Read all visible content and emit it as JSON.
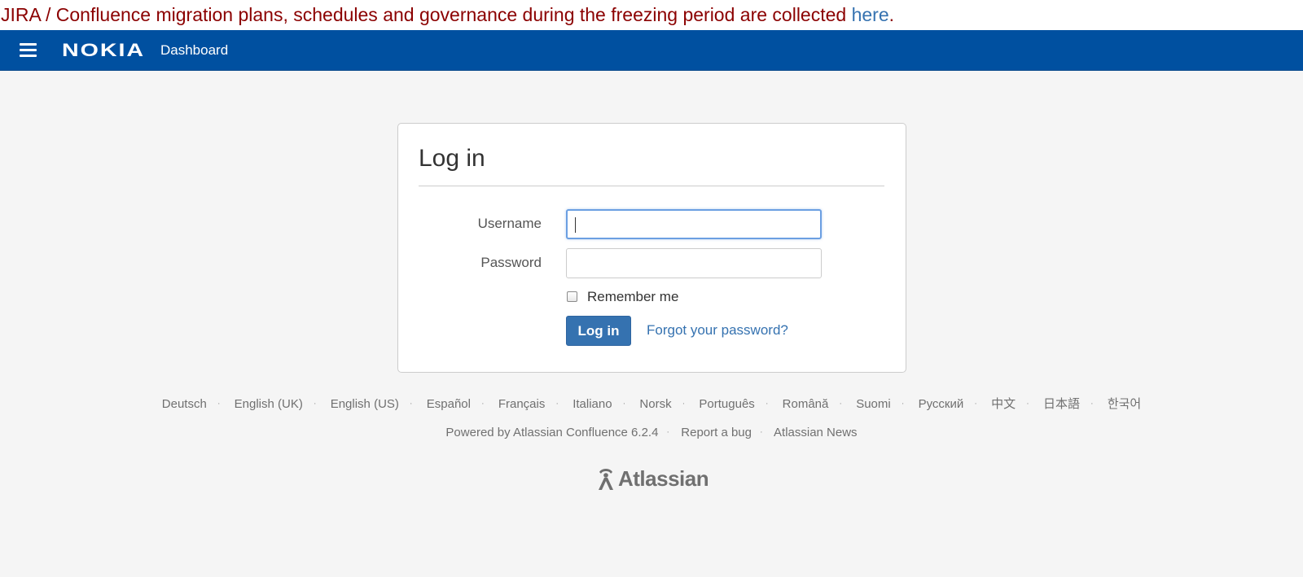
{
  "banner": {
    "text": "JIRA / Confluence migration plans, schedules and governance during the freezing period are collected ",
    "link_label": "here",
    "tail": "."
  },
  "header": {
    "brand": "NOKIA",
    "nav_dashboard": "Dashboard",
    "color": "#0050a0"
  },
  "login": {
    "title": "Log in",
    "username_label": "Username",
    "username_value": "",
    "password_label": "Password",
    "password_value": "",
    "remember_label": "Remember me",
    "remember_checked": false,
    "submit_label": "Log in",
    "forgot_label": "Forgot your password?"
  },
  "languages": [
    "Deutsch",
    "English (UK)",
    "English (US)",
    "Español",
    "Français",
    "Italiano",
    "Norsk",
    "Português",
    "Română",
    "Suomi",
    "Русский",
    "中文",
    "日本語",
    "한국어"
  ],
  "footer": {
    "powered_by": "Powered by Atlassian Confluence 6.2.4",
    "report_bug": "Report a bug",
    "news": "Atlassian News",
    "logo_text": "Atlassian"
  },
  "colors": {
    "link": "#3572b0",
    "banner_text": "#8b0000",
    "button": "#3572b0"
  }
}
